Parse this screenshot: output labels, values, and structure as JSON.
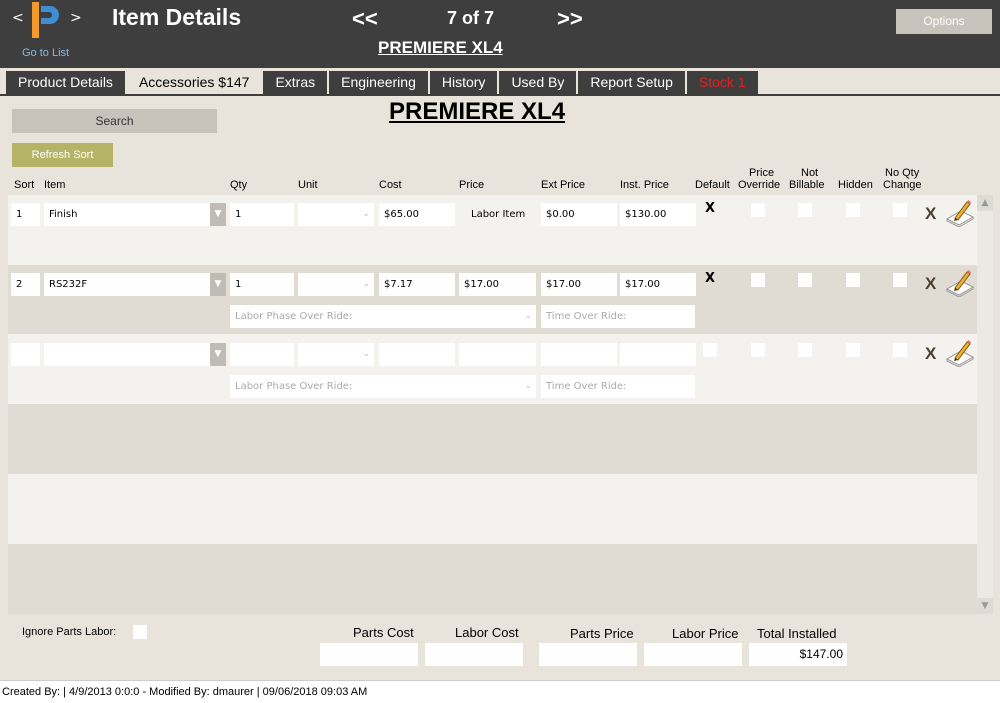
{
  "header": {
    "nav_prev_small": "<",
    "nav_next_small": ">",
    "go_to_list": "Go to List",
    "title": "Item Details",
    "pager_prev": "<<",
    "pager_count": "7 of 7",
    "pager_next": ">>",
    "item_name": "PREMIERE XL4",
    "options_label": "Options"
  },
  "tabs": [
    {
      "label": "Product Details"
    },
    {
      "label": "Accessories $147"
    },
    {
      "label": "Extras"
    },
    {
      "label": "Engineering"
    },
    {
      "label": "History"
    },
    {
      "label": "Used By"
    },
    {
      "label": "Report Setup"
    },
    {
      "label": "Stock 1"
    }
  ],
  "main": {
    "title": "PREMIERE XL4",
    "search_label": "Search",
    "refresh_label": "Refresh Sort"
  },
  "columns": {
    "sort": "Sort",
    "item": "Item",
    "qty": "Qty",
    "unit": "Unit",
    "cost": "Cost",
    "price": "Price",
    "ext_price": "Ext Price",
    "inst_price": "Inst. Price",
    "default": "Default",
    "price_override_1": "Price",
    "price_override_2": "Override",
    "not_billable_1": "Not",
    "not_billable_2": "Billable",
    "hidden": "Hidden",
    "no_qty_1": "No Qty",
    "no_qty_2": "Change"
  },
  "rows": [
    {
      "sort": "1",
      "item": "Finish",
      "qty": "1",
      "unit": "",
      "cost": "$65.00",
      "price": "Labor Item",
      "ext_price": "$0.00",
      "inst_price": "$130.00",
      "default_mark": "X",
      "delete": "X"
    },
    {
      "sort": "2",
      "item": "RS232F",
      "qty": "1",
      "unit": "",
      "cost": "$7.17",
      "price": "$17.00",
      "ext_price": "$17.00",
      "inst_price": "$17.00",
      "default_mark": "X",
      "delete": "X",
      "labor_phase_placeholder": "Labor Phase Over Ride:",
      "time_placeholder": "Time Over Ride:"
    },
    {
      "sort": "",
      "item": "",
      "qty": "",
      "unit": "",
      "cost": "",
      "price": "",
      "ext_price": "",
      "inst_price": "",
      "delete": "X",
      "labor_phase_placeholder": "Labor Phase Over Ride:",
      "time_placeholder": "Time Over Ride:"
    }
  ],
  "footer": {
    "ignore_parts_labor": "Ignore Parts Labor:",
    "parts_cost_label": "Parts Cost",
    "labor_cost_label": "Labor Cost",
    "parts_price_label": "Parts Price",
    "labor_price_label": "Labor Price",
    "total_installed_label": "Total Installed",
    "parts_cost": "",
    "labor_cost": "",
    "parts_price": "",
    "labor_price": "",
    "total_installed": "$147.00"
  },
  "status": {
    "text": "Created By:  | 4/9/2013 0:0:0 - Modified By: dmaurer | 09/06/2018 09:03 AM"
  },
  "colors": {
    "topbar": "#3e3e3e",
    "background": "#e8e4dc",
    "refresh_button": "#b5b466",
    "stock_tab_text": "#e02020",
    "logo_orange": "#f29a2e",
    "logo_blue": "#3d8fd1"
  },
  "icons": {
    "logo": "ip-logo",
    "edit": "pencil-edit-icon",
    "delete": "x-delete-icon"
  }
}
